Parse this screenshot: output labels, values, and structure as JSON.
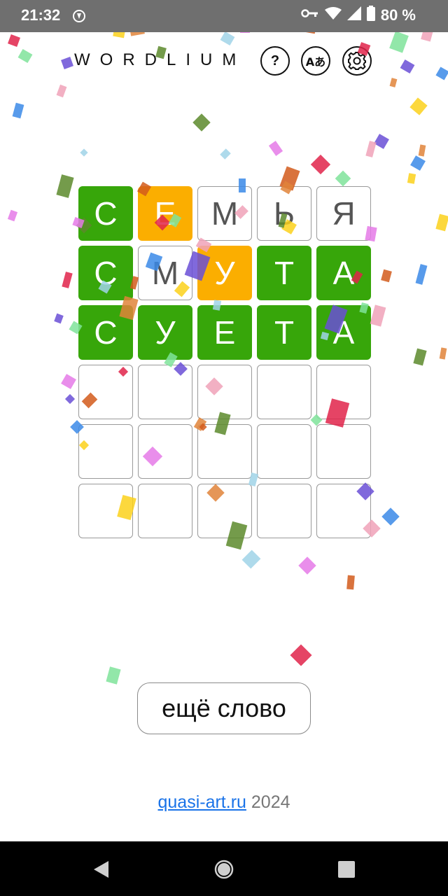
{
  "status_bar": {
    "time": "21:32",
    "battery": "80 %",
    "icons": [
      "app-notification-icon",
      "key-icon",
      "wifi-icon",
      "signal-icon",
      "battery-icon"
    ]
  },
  "header": {
    "logo": "WORDLIUM",
    "buttons": [
      {
        "name": "help-button",
        "icon": "question-icon",
        "label": "?"
      },
      {
        "name": "language-button",
        "icon": "translate-icon",
        "label": "Aあ"
      },
      {
        "name": "settings-button",
        "icon": "gear-icon"
      }
    ]
  },
  "board": {
    "rows": [
      [
        {
          "letter": "С",
          "state": "green"
        },
        {
          "letter": "Е",
          "state": "yellow"
        },
        {
          "letter": "М",
          "state": "empty"
        },
        {
          "letter": "Ь",
          "state": "empty"
        },
        {
          "letter": "Я",
          "state": "empty"
        }
      ],
      [
        {
          "letter": "С",
          "state": "green"
        },
        {
          "letter": "М",
          "state": "empty"
        },
        {
          "letter": "У",
          "state": "yellow"
        },
        {
          "letter": "Т",
          "state": "green"
        },
        {
          "letter": "А",
          "state": "green"
        }
      ],
      [
        {
          "letter": "С",
          "state": "green"
        },
        {
          "letter": "У",
          "state": "green"
        },
        {
          "letter": "Е",
          "state": "green"
        },
        {
          "letter": "Т",
          "state": "green"
        },
        {
          "letter": "А",
          "state": "green"
        }
      ],
      [
        {
          "letter": "",
          "state": "empty"
        },
        {
          "letter": "",
          "state": "empty"
        },
        {
          "letter": "",
          "state": "empty"
        },
        {
          "letter": "",
          "state": "empty"
        },
        {
          "letter": "",
          "state": "empty"
        }
      ],
      [
        {
          "letter": "",
          "state": "empty"
        },
        {
          "letter": "",
          "state": "empty"
        },
        {
          "letter": "",
          "state": "empty"
        },
        {
          "letter": "",
          "state": "empty"
        },
        {
          "letter": "",
          "state": "empty"
        }
      ],
      [
        {
          "letter": "",
          "state": "empty"
        },
        {
          "letter": "",
          "state": "empty"
        },
        {
          "letter": "",
          "state": "empty"
        },
        {
          "letter": "",
          "state": "empty"
        },
        {
          "letter": "",
          "state": "empty"
        }
      ]
    ]
  },
  "actions": {
    "more_word": "ещё слово"
  },
  "footer": {
    "link_text": "quasi-art.ru",
    "year": "2024"
  },
  "colors": {
    "green": "#37a60a",
    "yellow": "#fbae00",
    "status_bar": "#6f6f6f",
    "link": "#1a73e8"
  },
  "nav_bar": {
    "items": [
      "back-icon",
      "home-icon",
      "recents-icon"
    ]
  }
}
